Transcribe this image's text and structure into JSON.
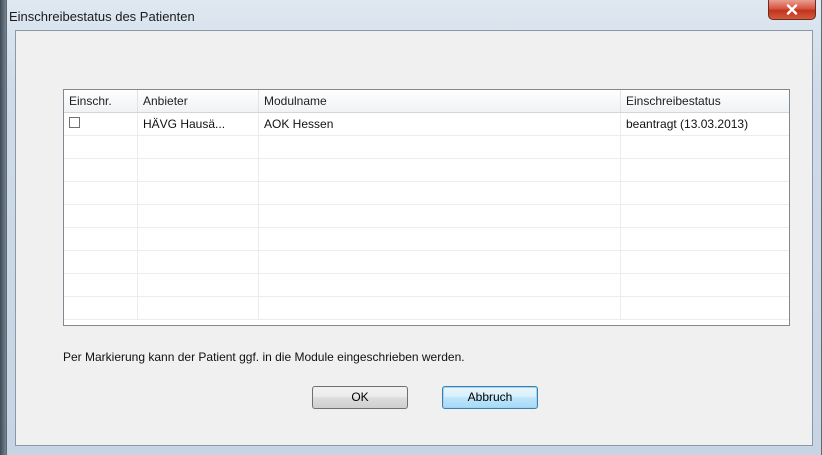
{
  "window": {
    "title": "Einschreibestatus des Patienten"
  },
  "table": {
    "columns": [
      "Einschr.",
      "Anbieter",
      "Modulname",
      "Einschreibestatus"
    ],
    "rows": [
      {
        "checked": false,
        "anbieter": "HÄVG Hausä...",
        "modulname": "AOK Hessen",
        "status": "beantragt (13.03.2013)"
      }
    ]
  },
  "hint": "Per Markierung kann der Patient ggf. in die Module eingeschrieben werden.",
  "buttons": {
    "ok": "OK",
    "cancel": "Abbruch"
  },
  "colors": {
    "close_button": "#c2331c",
    "default_button_border": "#3c7fb1"
  }
}
